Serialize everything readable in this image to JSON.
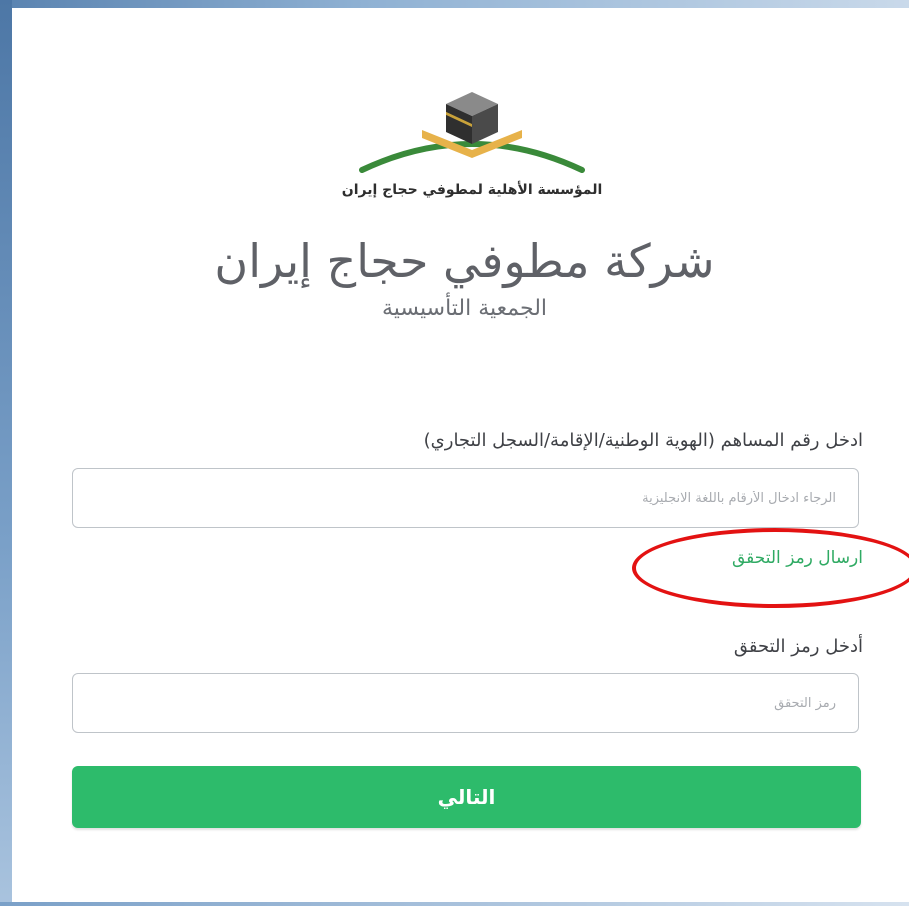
{
  "logo": {
    "caption": "المؤسسة الأهلية لمطوفي حجاج إيران",
    "colors": {
      "arc_green": "#3a8a3a",
      "arc_gold": "#e7b24a",
      "cube": "#3c3c3c"
    }
  },
  "header": {
    "title": "شركة مطوفي حجاج إيران",
    "subtitle": "الجمعية التأسيسية"
  },
  "form": {
    "id_label": "ادخل رقم المساهم (الهوية الوطنية/الإقامة/السجل التجاري)",
    "id_placeholder": "الرجاء ادخال الأرقام باللغة الانجليزية",
    "send_code_link": "ارسال رمز التحقق",
    "code_label": "أدخل رمز التحقق",
    "code_placeholder": "رمز التحقق",
    "next_button": "التالي"
  },
  "colors": {
    "accent_green": "#2dbb6b",
    "link_green": "#2faa63",
    "annotation_red": "#e31212"
  }
}
